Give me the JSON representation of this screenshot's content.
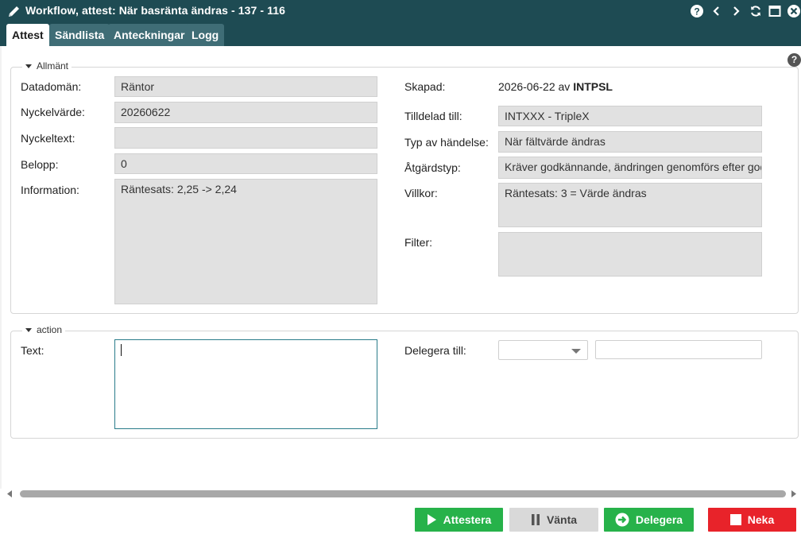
{
  "window": {
    "title": "Workflow, attest: När basränta ändras - 137 - 116",
    "tabs": [
      "Attest",
      "Sändlista",
      "Anteckningar",
      "Logg"
    ],
    "active_tab": "Attest"
  },
  "allmant": {
    "legend": "Allmänt",
    "datadoman_label": "Datadomän:",
    "datadoman_value": "Räntor",
    "nyckelvarde_label": "Nyckelvärde:",
    "nyckelvarde_value": "20260622",
    "nyckeltext_label": "Nyckeltext:",
    "nyckeltext_value": "",
    "belopp_label": "Belopp:",
    "belopp_value": "0",
    "information_label": "Information:",
    "information_value": "Räntesats: 2,25 -> 2,24",
    "skapad_label": "Skapad:",
    "skapad_date": "2026-06-22 av",
    "skapad_user": "INTPSL",
    "tilldelad_label": "Tilldelad till:",
    "tilldelad_value": "INTXXX - TripleX",
    "typ_label": "Typ av händelse:",
    "typ_value": "När fältvärde ändras",
    "atgardstyp_label": "Åtgärdstyp:",
    "atgardstyp_value": "Kräver godkännande, ändringen genomförs efter god",
    "villkor_label": "Villkor:",
    "villkor_value": "Räntesats: 3 = Värde ändras",
    "filter_label": "Filter:",
    "filter_value": ""
  },
  "action": {
    "legend": "action",
    "text_label": "Text:",
    "text_value": "",
    "delegera_label": "Delegera till:",
    "delegera_select_value": "",
    "delegera_input_value": ""
  },
  "footer": {
    "attestera": "Attestera",
    "vanta": "Vänta",
    "delegera": "Delegera",
    "neka": "Neka"
  },
  "colors": {
    "titlebar": "#1e4b53",
    "green": "#27b24a",
    "red": "#e8232a",
    "field_bg": "#e1e1e1"
  },
  "icons": [
    "pencil-icon",
    "help-icon",
    "chevron-left-icon",
    "chevron-right-icon",
    "refresh-icon",
    "maximize-icon",
    "close-icon",
    "play-icon",
    "pause-icon",
    "arrow-right-circle-icon",
    "stop-square-icon"
  ]
}
